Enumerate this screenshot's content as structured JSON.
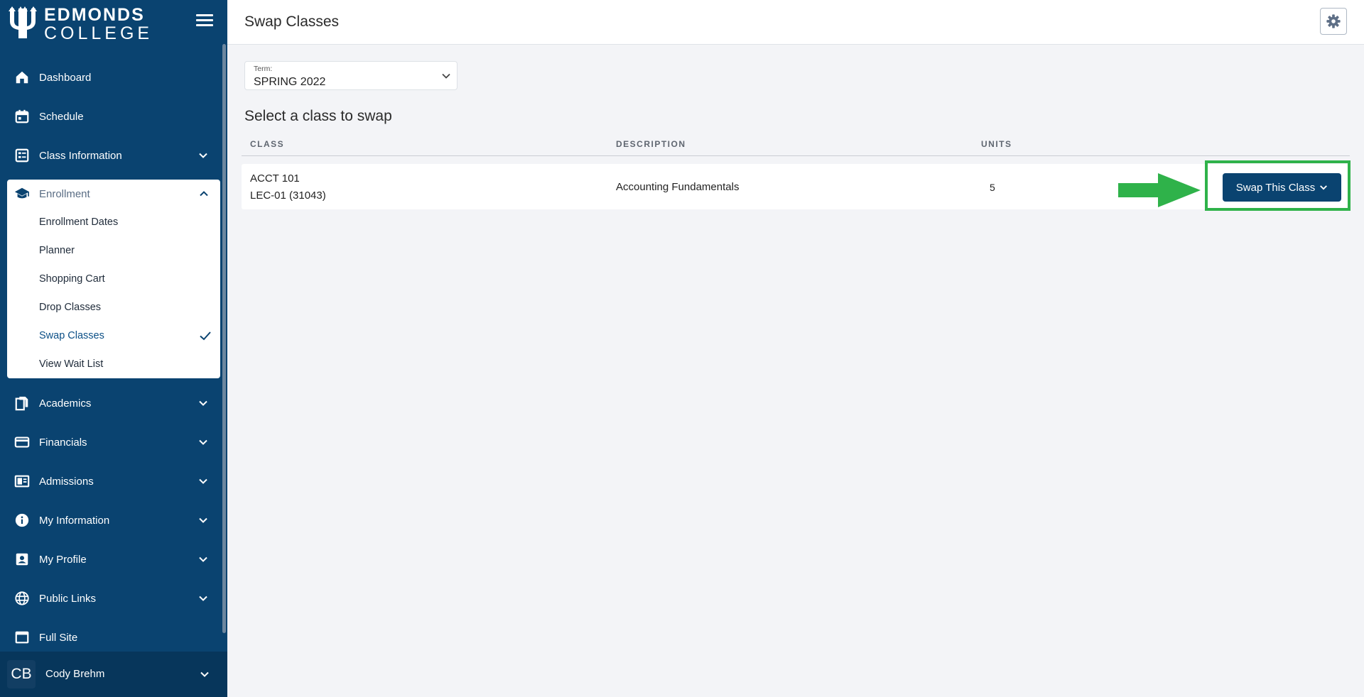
{
  "brand": {
    "line1": "EDMONDS",
    "line2": "COLLEGE"
  },
  "header": {
    "title": "Swap Classes"
  },
  "sidebar": {
    "items": [
      {
        "label": "Dashboard",
        "icon": "home-icon"
      },
      {
        "label": "Schedule",
        "icon": "calendar-icon"
      },
      {
        "label": "Class Information",
        "icon": "list-icon",
        "expandable": true
      },
      {
        "label": "Academics",
        "icon": "documents-icon",
        "expandable": true
      },
      {
        "label": "Financials",
        "icon": "credit-card-icon",
        "expandable": true
      },
      {
        "label": "Admissions",
        "icon": "newspaper-icon",
        "expandable": true
      },
      {
        "label": "My Information",
        "icon": "info-icon",
        "expandable": true
      },
      {
        "label": "My Profile",
        "icon": "profile-icon",
        "expandable": true
      },
      {
        "label": "Public Links",
        "icon": "globe-icon",
        "expandable": true
      },
      {
        "label": "Full Site",
        "icon": "window-icon"
      }
    ],
    "enrollment": {
      "label": "Enrollment",
      "icon": "graduation-cap-icon",
      "expanded": true,
      "subitems": [
        {
          "label": "Enrollment Dates"
        },
        {
          "label": "Planner"
        },
        {
          "label": "Shopping Cart"
        },
        {
          "label": "Drop Classes"
        },
        {
          "label": "Swap Classes",
          "active": true
        },
        {
          "label": "View Wait List"
        }
      ]
    },
    "user": {
      "initials": "CB",
      "name": "Cody Brehm"
    }
  },
  "term": {
    "label": "Term:",
    "value": "SPRING 2022"
  },
  "section_title": "Select a class to swap",
  "table": {
    "headers": [
      "CLASS",
      "DESCRIPTION",
      "UNITS"
    ],
    "rows": [
      {
        "class_code": "ACCT 101",
        "section": "LEC-01 (31043)",
        "description": "Accounting Fundamentals",
        "units": "5",
        "action": "Swap This Class"
      }
    ]
  },
  "colors": {
    "sidebar": "#0a4370",
    "accent": "#0a4370",
    "highlight": "#2fb24a",
    "background": "#f3f4f7"
  }
}
